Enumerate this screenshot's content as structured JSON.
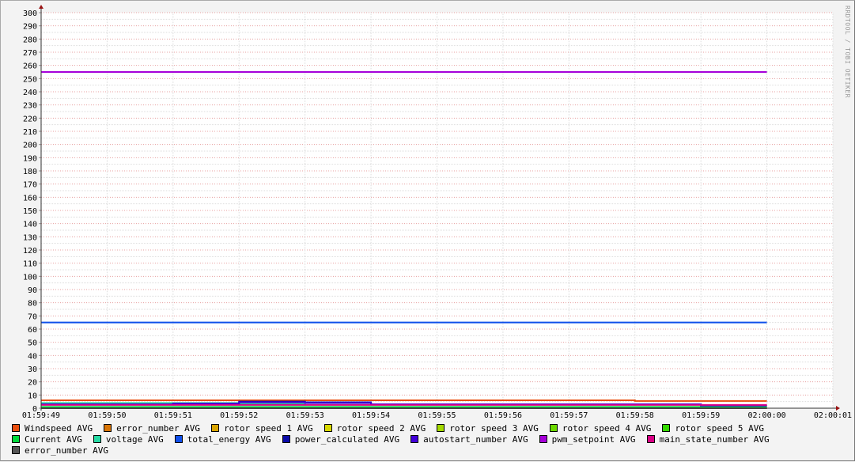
{
  "chart_data": {
    "type": "line",
    "title": "",
    "watermark": "RRDTOOL / TOBI OETIKER",
    "ylim": [
      0,
      300
    ],
    "y_ticks": [
      0,
      10,
      20,
      30,
      40,
      50,
      60,
      70,
      80,
      90,
      100,
      110,
      120,
      130,
      140,
      150,
      160,
      170,
      180,
      190,
      200,
      210,
      220,
      230,
      240,
      250,
      260,
      270,
      280,
      290,
      300
    ],
    "x_ticks": [
      "01:59:49",
      "01:59:50",
      "01:59:51",
      "01:59:52",
      "01:59:53",
      "01:59:54",
      "01:59:55",
      "01:59:56",
      "01:59:57",
      "01:59:58",
      "01:59:59",
      "02:00:00",
      "02:00:01"
    ],
    "grid": true,
    "legend_position": "bottom",
    "series": [
      {
        "name": "Windspeed AVG",
        "color": "#EA4F0F",
        "values": [
          6,
          6,
          6,
          6,
          6,
          6,
          6,
          6,
          6,
          5.5,
          5.5
        ]
      },
      {
        "name": "error_number AVG",
        "color": "#D97506",
        "values": [
          0,
          0,
          0,
          0,
          0,
          0,
          0,
          0,
          0,
          0,
          0
        ]
      },
      {
        "name": "rotor speed 1 AVG",
        "color": "#D9A400",
        "values": [
          0,
          0,
          0,
          0,
          0,
          0,
          0,
          0,
          0,
          0,
          0
        ]
      },
      {
        "name": "rotor speed 2 AVG",
        "color": "#D9D900",
        "values": [
          0,
          0,
          0,
          0,
          0,
          0,
          0,
          0,
          0,
          0,
          0
        ]
      },
      {
        "name": "rotor speed 3 AVG",
        "color": "#A3D900",
        "values": [
          0,
          0,
          0,
          0,
          0,
          0,
          0,
          0,
          0,
          0,
          0
        ]
      },
      {
        "name": "rotor speed 4 AVG",
        "color": "#6CD900",
        "values": [
          0,
          0,
          0,
          0,
          0,
          0,
          0,
          0,
          0,
          0,
          0
        ]
      },
      {
        "name": "rotor speed 5 AVG",
        "color": "#34D900",
        "values": [
          0,
          0,
          0,
          0,
          0,
          0,
          0,
          0,
          0,
          0,
          0
        ]
      },
      {
        "name": "Current AVG",
        "color": "#00D93C",
        "values": [
          1,
          1,
          1,
          1,
          1,
          1,
          1,
          1,
          1,
          1,
          1
        ]
      },
      {
        "name": "voltage AVG",
        "color": "#26D9A3",
        "values": [
          4,
          4,
          4,
          3.5,
          4,
          3,
          3,
          3,
          3,
          3,
          2
        ]
      },
      {
        "name": "total_energy AVG",
        "color": "#0F4FEA",
        "values": [
          65,
          65,
          65,
          65,
          65,
          65,
          65,
          65,
          65,
          65,
          65
        ]
      },
      {
        "name": "power_calculated AVG",
        "color": "#0A0AA8",
        "values": [
          3,
          3,
          3.5,
          5,
          4.5,
          3,
          3,
          3,
          3,
          3,
          2
        ]
      },
      {
        "name": "autostart_number AVG",
        "color": "#4200D9",
        "values": [
          3,
          3,
          3.5,
          4.5,
          4,
          3,
          3,
          3,
          3,
          3,
          2
        ]
      },
      {
        "name": "pwm_setpoint AVG",
        "color": "#A600D9",
        "values": [
          255,
          255,
          255,
          255,
          255,
          255,
          255,
          255,
          255,
          255,
          255
        ]
      },
      {
        "name": "main_state_number AVG",
        "color": "#D90085",
        "values": [
          2.5,
          2.5,
          2.5,
          2.5,
          2.5,
          2.5,
          2.5,
          2.5,
          2.5,
          2.5,
          2.5
        ]
      },
      {
        "name": "error_number AVG",
        "color": "#555555",
        "values": [
          0,
          0,
          0,
          0,
          0,
          0,
          0,
          0,
          0,
          0,
          0
        ]
      }
    ]
  }
}
